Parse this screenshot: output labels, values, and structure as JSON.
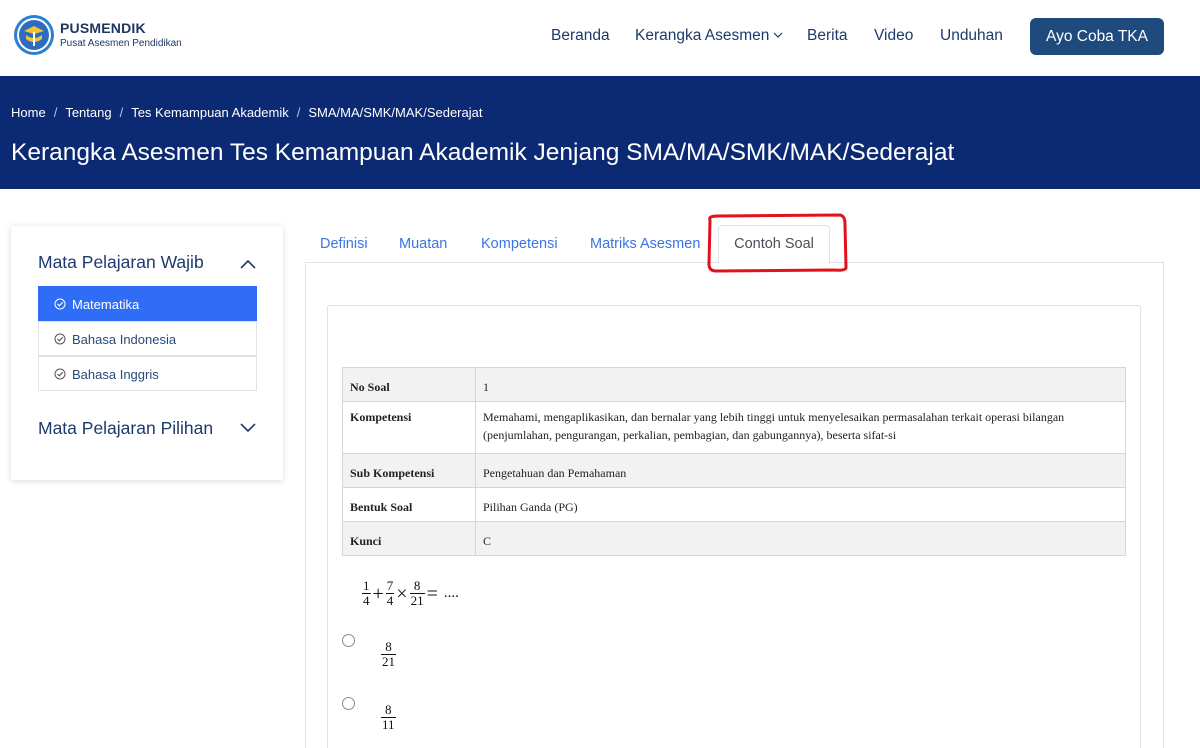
{
  "brand": {
    "name": "PUSMENDIK",
    "subtitle": "Pusat Asesmen Pendidikan",
    "logo_icon": "tut-wuri-handayani-logo"
  },
  "nav": {
    "items": [
      "Beranda",
      "Kerangka Asesmen",
      "Berita",
      "Video",
      "Unduhan"
    ],
    "cta": "Ayo Coba TKA"
  },
  "breadcrumb": [
    "Home",
    "Tentang",
    "Tes Kemampuan Akademik",
    "SMA/MA/SMK/MAK/Sederajat"
  ],
  "page_title": "Kerangka Asesmen Tes Kemampuan Akademik Jenjang SMA/MA/SMK/MAK/Sederajat",
  "sidebar": {
    "wajib_title": "Mata Pelajaran Wajib",
    "wajib_items": [
      "Matematika",
      "Bahasa Indonesia",
      "Bahasa Inggris"
    ],
    "active_item": "Matematika",
    "pilihan_title": "Mata Pelajaran Pilihan"
  },
  "tabs": {
    "items": [
      "Definisi",
      "Muatan",
      "Kompetensi",
      "Matriks Asesmen",
      "Contoh Soal"
    ],
    "active": "Contoh Soal"
  },
  "soal": {
    "rows": [
      {
        "key": "No Soal",
        "value": "1"
      },
      {
        "key": "Kompetensi",
        "value": "Memahami, mengaplikasikan, dan bernalar yang lebih tinggi untuk menyelesaikan permasalahan terkait operasi bilangan (penjumlahan, pengurangan, perkalian, pembagian, dan gabungannya), beserta sifat-si"
      },
      {
        "key": "Sub Kompetensi",
        "value": "Pengetahuan dan Pemahaman"
      },
      {
        "key": "Bentuk Soal",
        "value": "Pilihan Ganda (PG)"
      },
      {
        "key": "Kunci",
        "value": "C"
      }
    ],
    "question": {
      "f1": {
        "num": "1",
        "den": "4"
      },
      "op1": "+",
      "f2": {
        "num": "7",
        "den": "4"
      },
      "op2": "×",
      "f3": {
        "num": "8",
        "den": "21"
      },
      "eq": "=",
      "tail": "...."
    },
    "options": [
      {
        "num": "8",
        "den": "21"
      },
      {
        "num": "8",
        "den": "11"
      }
    ]
  },
  "colors": {
    "hero_bg": "#0c2a74",
    "nav_text": "#1d3a6b",
    "cta_bg": "#1e4a7e",
    "active_subject": "#2f6df6",
    "tab_link": "#3b74e6",
    "annotation": "#e0131d"
  }
}
